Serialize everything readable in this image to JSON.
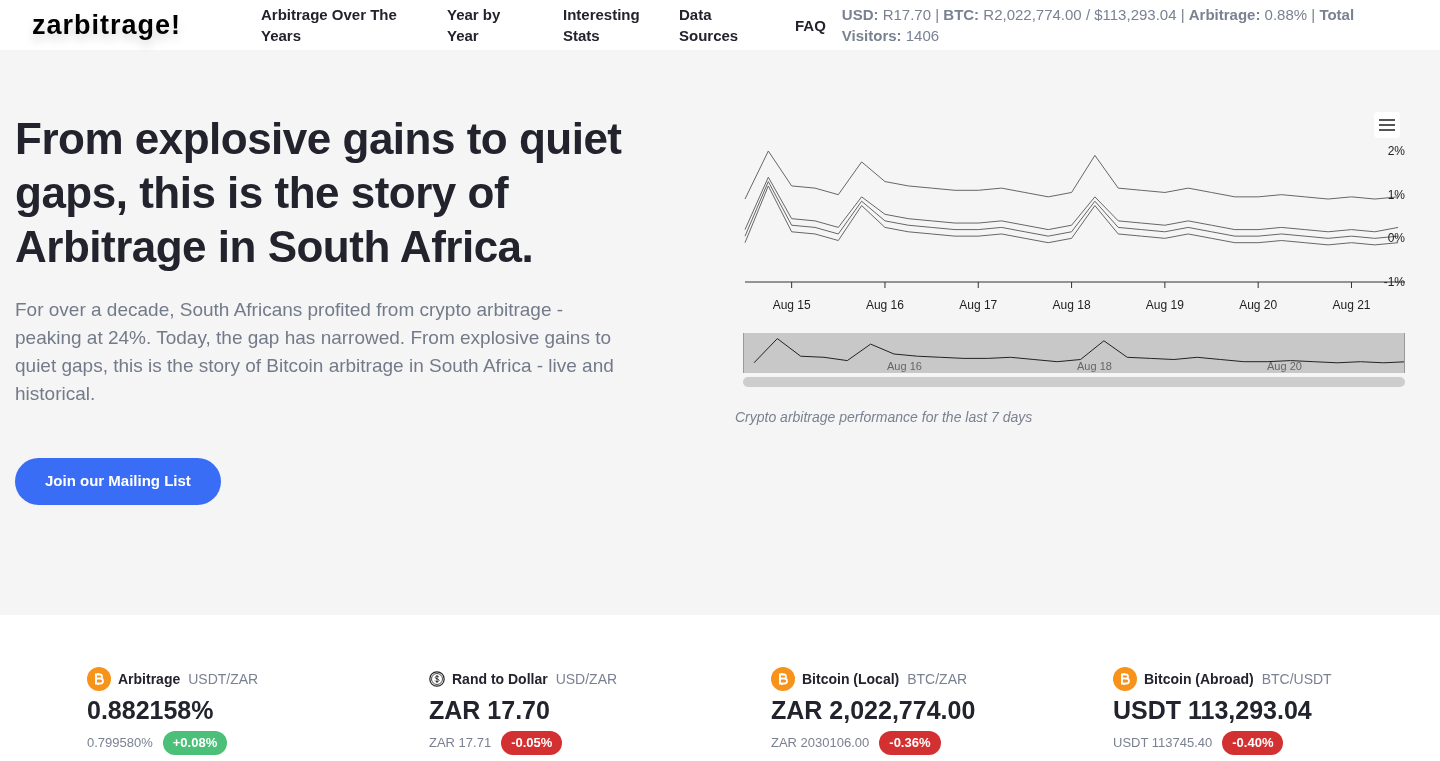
{
  "header": {
    "logo": "zarbitrage!",
    "nav": [
      {
        "label": "Arbitrage Over The Years"
      },
      {
        "label": "Year by Year"
      },
      {
        "label": "Interesting Stats"
      },
      {
        "label": "Data Sources"
      },
      {
        "label": "FAQ"
      }
    ],
    "stats": "**USD:** R17.70 | **BTC:** R2,022,774.00 / $113,293.04 | **Arbitrage:** 0.88% | **Total Visitors:** 1406"
  },
  "hero": {
    "title": "From explosive gains to quiet gaps, this is the story of Arbitrage in South Africa.",
    "text": "For over a decade, South Africans profited from crypto arbitrage - peaking at 24%. Today, the gap has narrowed. From explosive gains to quiet gaps, this is the story of Bitcoin arbitrage in South Africa - live and historical.",
    "button": "Join our Mailing List"
  },
  "chart": {
    "chart_data": {
      "type": "line",
      "categories": [
        null,
        null,
        "Aug 15",
        null,
        null,
        null,
        "Aug 16",
        null,
        null,
        null,
        "Aug 17",
        null,
        null,
        null,
        "Aug 18",
        null,
        null,
        null,
        "Aug 19",
        null,
        null,
        null,
        "Aug 20",
        null,
        null,
        null,
        "Aug 21",
        null,
        null
      ],
      "series": [
        {
          "color": "#666666",
          "values": [
            0.9,
            2.0,
            1.2,
            1.15,
            1.0,
            1.75,
            1.3,
            1.2,
            1.15,
            1.1,
            1.1,
            1.15,
            1.05,
            0.95,
            1.05,
            1.9,
            1.15,
            1.1,
            1.05,
            1.15,
            1.05,
            0.95,
            0.95,
            1.0,
            0.95,
            0.9,
            0.95,
            0.9,
            0.95
          ]
        },
        {
          "color": "#666666",
          "values": [
            0.2,
            1.4,
            0.45,
            0.4,
            0.25,
            0.95,
            0.55,
            0.45,
            0.4,
            0.35,
            0.35,
            0.4,
            0.3,
            0.2,
            0.3,
            0.95,
            0.4,
            0.35,
            0.3,
            0.4,
            0.3,
            0.2,
            0.2,
            0.25,
            0.2,
            0.15,
            0.2,
            0.15,
            0.25
          ]
        },
        {
          "color": "#666666",
          "values": [
            0.05,
            1.3,
            0.3,
            0.25,
            0.1,
            0.85,
            0.4,
            0.3,
            0.25,
            0.2,
            0.2,
            0.25,
            0.15,
            0.05,
            0.15,
            0.85,
            0.25,
            0.2,
            0.15,
            0.25,
            0.15,
            0.05,
            0.05,
            0.1,
            0.05,
            0.0,
            0.05,
            0.0,
            0.05
          ]
        },
        {
          "color": "#666666",
          "values": [
            -0.1,
            1.2,
            0.15,
            0.1,
            -0.05,
            0.75,
            0.25,
            0.15,
            0.1,
            0.05,
            0.05,
            0.1,
            0.0,
            -0.1,
            0.0,
            0.75,
            0.1,
            0.05,
            0.0,
            0.1,
            0.0,
            -0.1,
            -0.1,
            -0.05,
            -0.1,
            -0.15,
            -0.1,
            -0.15,
            -0.1
          ]
        }
      ],
      "ylim": [
        -1,
        2
      ],
      "yticks": [
        {
          "value": 2,
          "label": "2%"
        },
        {
          "value": 1,
          "label": "1%"
        },
        {
          "value": 0,
          "label": "0%"
        },
        {
          "value": -1,
          "label": "-1%"
        }
      ]
    },
    "navigator_labels": [
      "Aug 16",
      "Aug 18",
      "Aug 20"
    ],
    "caption": "Crypto arbitrage performance for the last 7 days"
  },
  "cards": [
    {
      "kind": "bitcoin",
      "title": "Arbitrage",
      "pair": "USDT/ZAR",
      "value": "0.882158%",
      "previous": "0.799580%",
      "change": "+0.08%",
      "up": true
    },
    {
      "kind": "dollar",
      "title": "Rand to Dollar",
      "pair": "USD/ZAR",
      "value": "ZAR 17.70",
      "previous": "ZAR 17.71",
      "change": "-0.05%",
      "up": false
    },
    {
      "kind": "bitcoin",
      "title": "Bitcoin (Local)",
      "pair": "BTC/ZAR",
      "value": "ZAR 2,022,774.00",
      "previous": "ZAR 2030106.00",
      "change": "-0.36%",
      "up": false
    },
    {
      "kind": "bitcoin",
      "title": "Bitcoin (Abroad)",
      "pair": "BTC/USDT",
      "value": "USDT 113,293.04",
      "previous": "USDT 113745.40",
      "change": "-0.40%",
      "up": false
    }
  ]
}
